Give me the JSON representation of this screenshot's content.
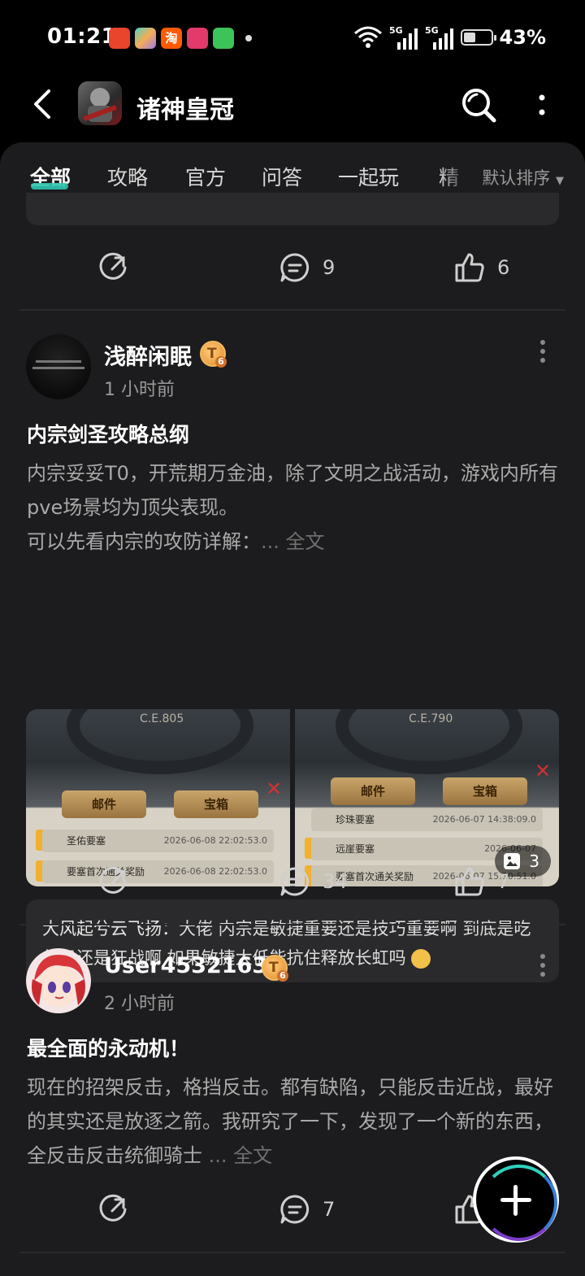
{
  "status_bar": {
    "time": "01:21",
    "network1": "5G",
    "network2": "5G",
    "battery": "43%",
    "battery_level": 0.43
  },
  "header": {
    "title": "诸神皇冠"
  },
  "tabs": [
    {
      "label": "全部",
      "active": true
    },
    {
      "label": "攻略"
    },
    {
      "label": "官方"
    },
    {
      "label": "问答"
    },
    {
      "label": "一起玩"
    },
    {
      "label": "精"
    }
  ],
  "sort_label": "默认排序",
  "prev_post": {
    "comments": "9",
    "likes": "6"
  },
  "posts": [
    {
      "author": "浅醉闲眠",
      "level": "6",
      "time": "1 小时前",
      "title": "内宗剑圣攻略总纲",
      "body_1": "内宗妥妥T0，开荒期万金油，除了文明之战活动，游戏内所有pve场景均为顶尖表现。",
      "body_2": "可以先看内宗的攻防详解：",
      "more": "... 全文",
      "image_count": "3",
      "images": [
        {
          "era": "C.E.805",
          "tab1": "邮件",
          "tab2": "宝箱",
          "rows": [
            {
              "name": "圣佑要塞",
              "date": "2026-06-08",
              "time": "22:02:53.0"
            },
            {
              "name": "要塞首次通关奖励",
              "date": "2026-06-08",
              "time": "22:02:53.0"
            }
          ]
        },
        {
          "era": "C.E.790",
          "tab1": "邮件",
          "tab2": "宝箱",
          "rows": [
            {
              "name": "珍珠要塞",
              "date": "2026-06-07",
              "time": "14:38:09.0"
            },
            {
              "name": "远崖要塞",
              "date": "2026-06-07",
              "time": ""
            },
            {
              "name": "要塞首次通关奖励",
              "date": "2026-06-07",
              "time": "15:10:51.0"
            }
          ]
        }
      ],
      "comment_author": "大风起兮云飞扬：",
      "comment_text": "大佬 内宗是敏捷重要还是技巧重要啊 到底是吃长弓还是狂战啊 如果敏捷太低能抗住释放长虹吗",
      "comments": "34",
      "likes": "7"
    },
    {
      "author": "User45321633",
      "level": "6",
      "time": "2 小时前",
      "title": "最全面的永动机！",
      "body": "现在的招架反击，格挡反击。都有缺陷，只能反击近战，最好的其实还是放逐之箭。我研究了一下，发现了一个新的东西，全反击反击统御骑士",
      "more": "... 全文",
      "comments": "7"
    }
  ],
  "colors": {
    "accent": "#2fc7b0",
    "panel": "#1c1c1e",
    "card": "#2a2a2c"
  }
}
